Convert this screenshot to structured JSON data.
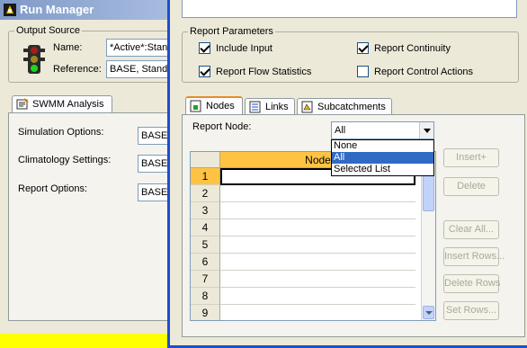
{
  "run_manager": {
    "title": "Run Manager",
    "output_source": {
      "legend": "Output Source",
      "name_label": "Name:",
      "name_value": "*Active*:Stan",
      "reference_label": "Reference:",
      "reference_value": "BASE, Standa"
    },
    "tab": {
      "label": "SWMM Analysis"
    },
    "rows": [
      {
        "label": "Simulation Options:",
        "value": "BASE,"
      },
      {
        "label": "Climatology Settings:",
        "value": "BASE,"
      },
      {
        "label": "Report Options:",
        "value": "BASE,"
      }
    ]
  },
  "dialog": {
    "report_parameters": {
      "legend": "Report Parameters",
      "include_input": {
        "label": "Include Input",
        "checked": true
      },
      "report_continuity": {
        "label": "Report Continuity",
        "checked": true
      },
      "report_flow_statistics": {
        "label": "Report Flow Statistics",
        "checked": true
      },
      "report_control_actions": {
        "label": "Report Control Actions",
        "checked": false
      }
    },
    "tabs": [
      {
        "label": "Nodes",
        "icon": "nodes-icon"
      },
      {
        "label": "Links",
        "icon": "links-icon"
      },
      {
        "label": "Subcatchments",
        "icon": "subcatchments-icon"
      }
    ],
    "report_node": {
      "label": "Report Node:",
      "selected": "All",
      "options": [
        "None",
        "All",
        "Selected List"
      ],
      "highlighted": "All"
    },
    "grid": {
      "column_header": "Node",
      "rows": [
        "1",
        "2",
        "3",
        "4",
        "5",
        "6",
        "7",
        "8",
        "9"
      ]
    },
    "buttons": {
      "insert_plus": "Insert+",
      "delete": "Delete",
      "clear_all": "Clear All...",
      "insert_rows": "Insert Rows...",
      "delete_rows": "Delete Rows",
      "set_rows": "Set Rows..."
    }
  }
}
